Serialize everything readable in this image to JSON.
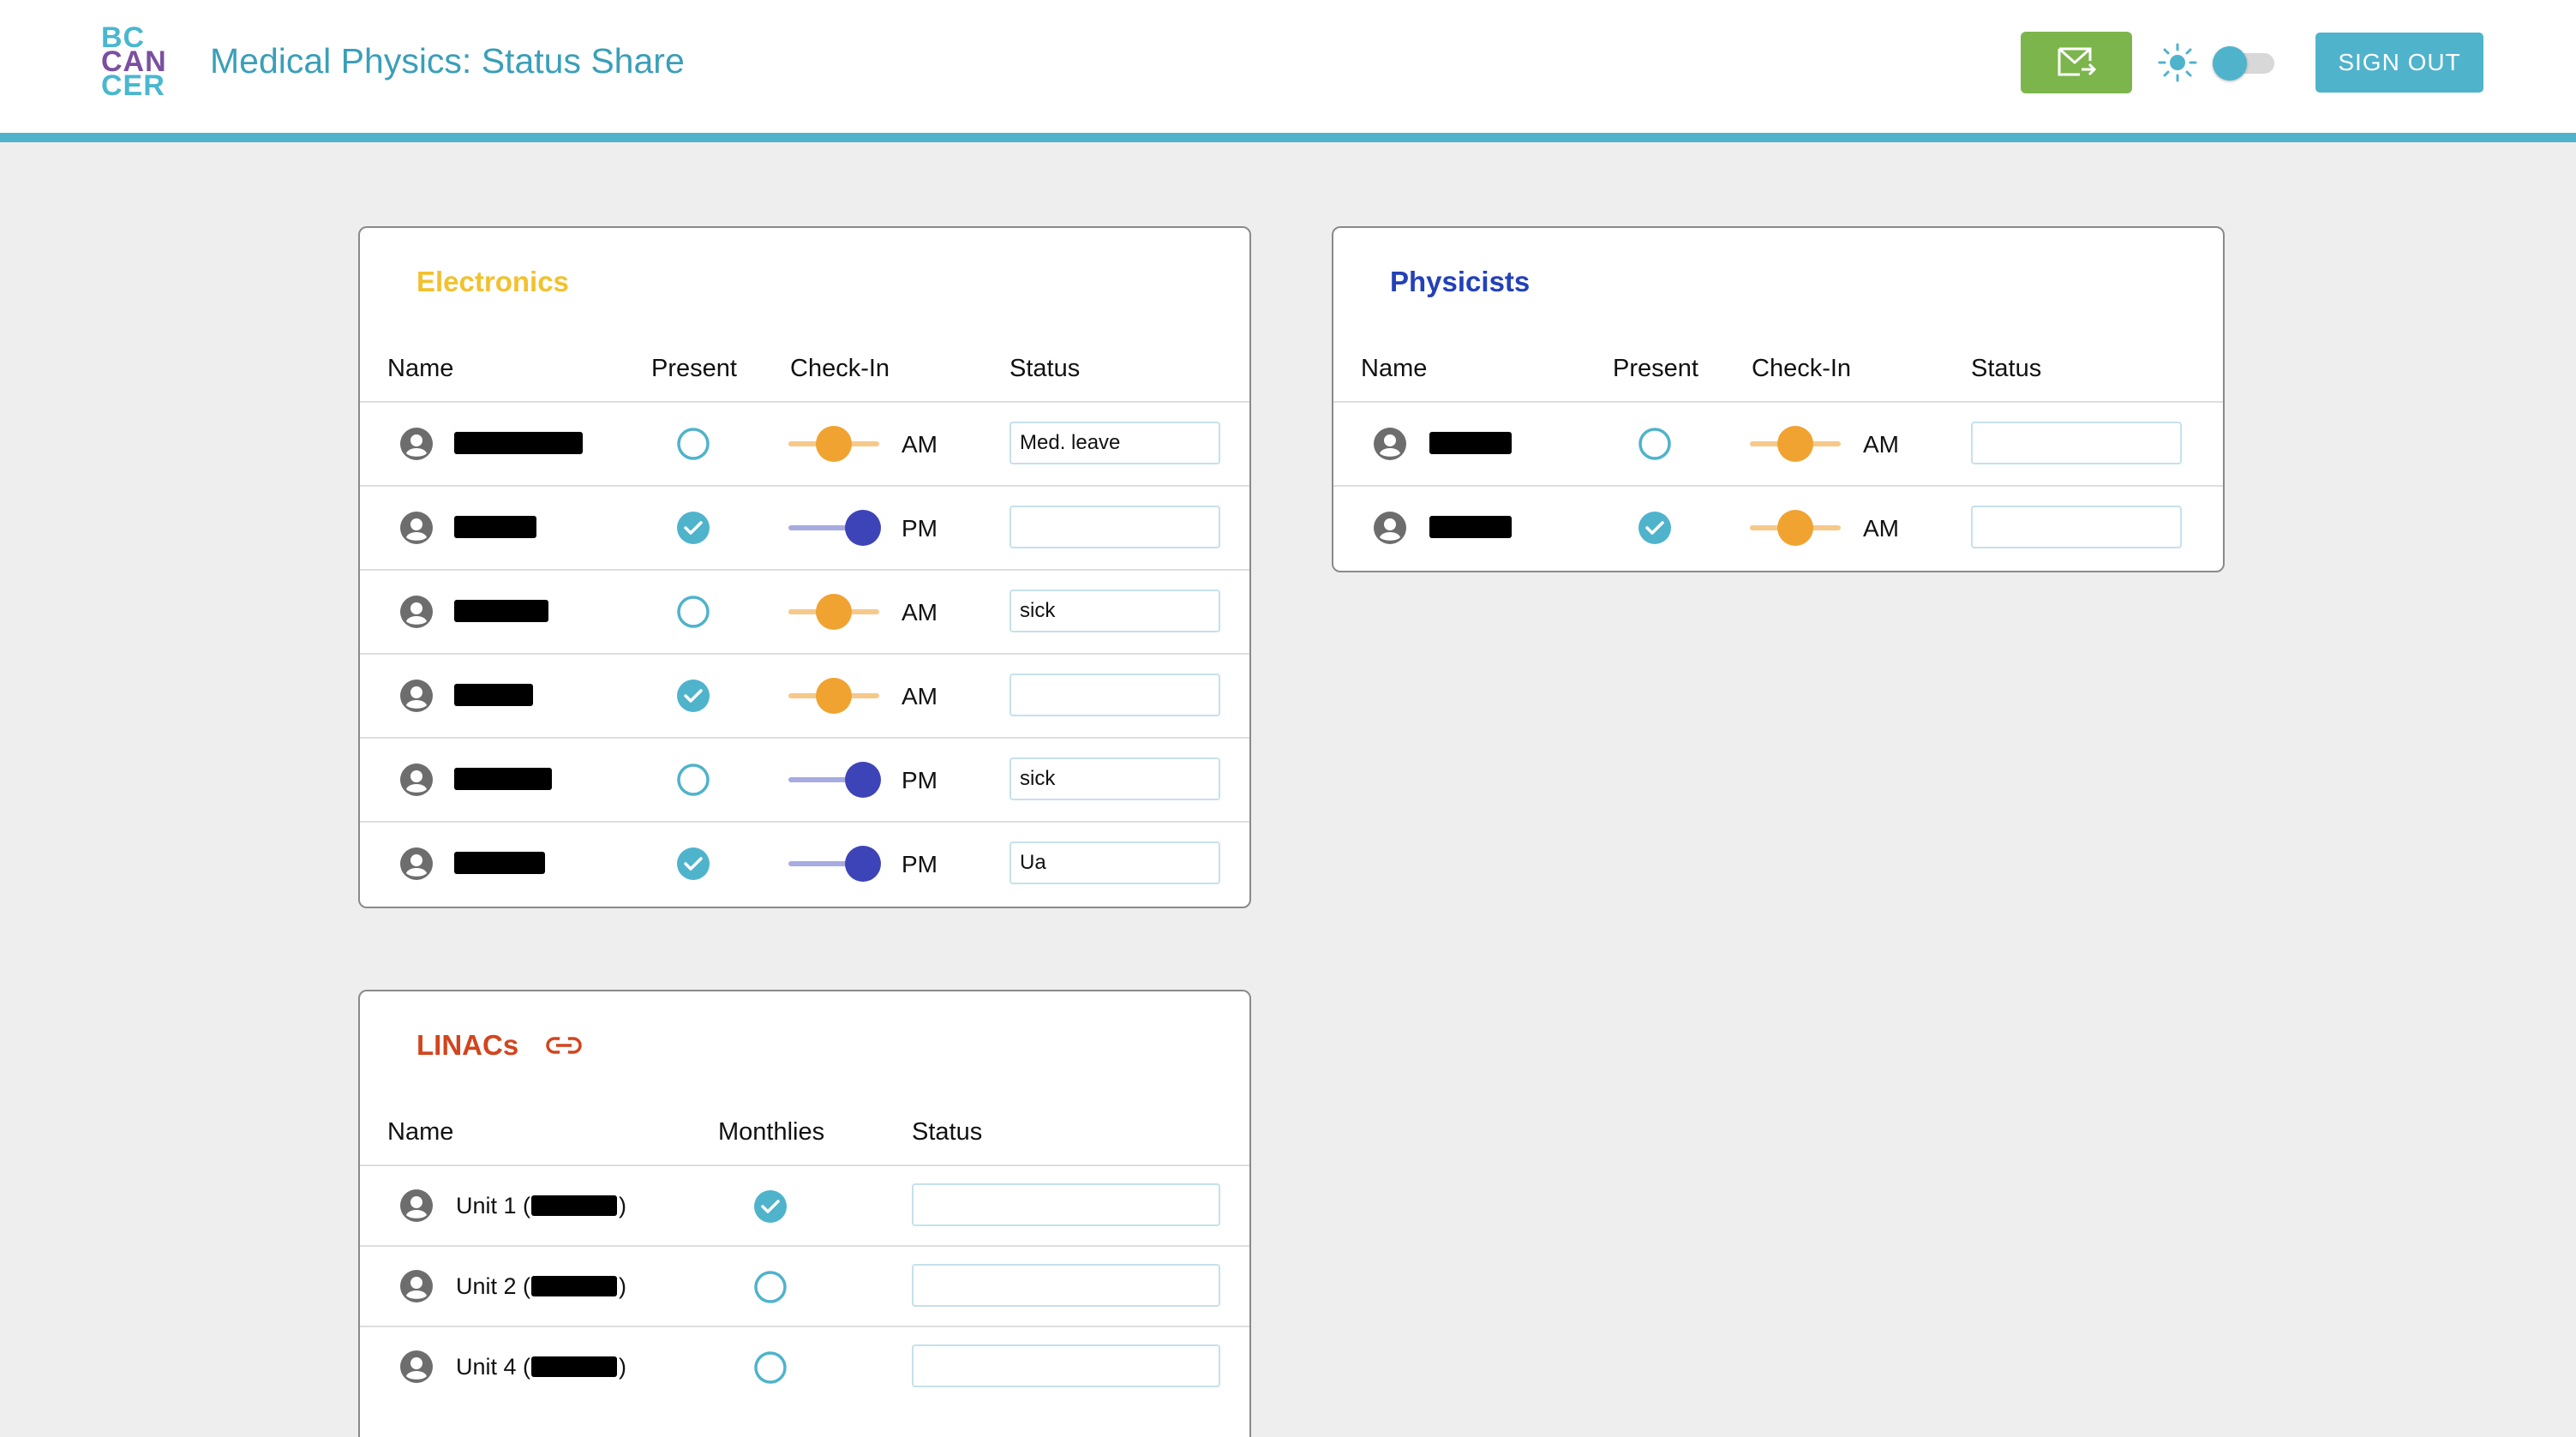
{
  "header": {
    "logo_lines": [
      "BC",
      "CAN",
      "CER"
    ],
    "title": "Medical Physics: Status Share",
    "mail_icon": "mail-forward-icon",
    "theme_icon": "sun-icon",
    "signout_label": "SIGN OUT"
  },
  "electronics": {
    "title": "Electronics",
    "title_color": "#f2c12e",
    "headers": [
      "Name",
      "Present",
      "Check-In",
      "Status"
    ],
    "rows": [
      {
        "present": false,
        "checkin": "AM",
        "status": "Med. leave"
      },
      {
        "present": true,
        "checkin": "PM",
        "status": ""
      },
      {
        "present": false,
        "checkin": "AM",
        "status": "sick"
      },
      {
        "present": true,
        "checkin": "AM",
        "status": ""
      },
      {
        "present": false,
        "checkin": "PM",
        "status": "sick"
      },
      {
        "present": true,
        "checkin": "PM",
        "status": "Ua"
      }
    ]
  },
  "physicists": {
    "title": "Physicists",
    "title_color": "#2341b8",
    "headers": [
      "Name",
      "Present",
      "Check-In",
      "Status"
    ],
    "rows": [
      {
        "present": false,
        "checkin": "AM",
        "status": ""
      },
      {
        "present": true,
        "checkin": "AM",
        "status": ""
      }
    ]
  },
  "linacs": {
    "title": "LINACs",
    "title_color": "#d2451e",
    "link_icon": "link-icon",
    "headers": [
      "Name",
      "Monthlies",
      "Status"
    ],
    "rows": [
      {
        "unit": "Unit 1 (",
        "close": ")",
        "monthlies": true,
        "status": ""
      },
      {
        "unit": "Unit 2 (",
        "close": ")",
        "monthlies": false,
        "status": ""
      },
      {
        "unit": "Unit 4 (",
        "close": ")",
        "monthlies": false,
        "status": ""
      }
    ]
  },
  "colors": {
    "accent": "#4fb3cc",
    "mail_button": "#7cb54b",
    "am_knob": "#f0a331",
    "pm_knob": "#3d44b8"
  }
}
